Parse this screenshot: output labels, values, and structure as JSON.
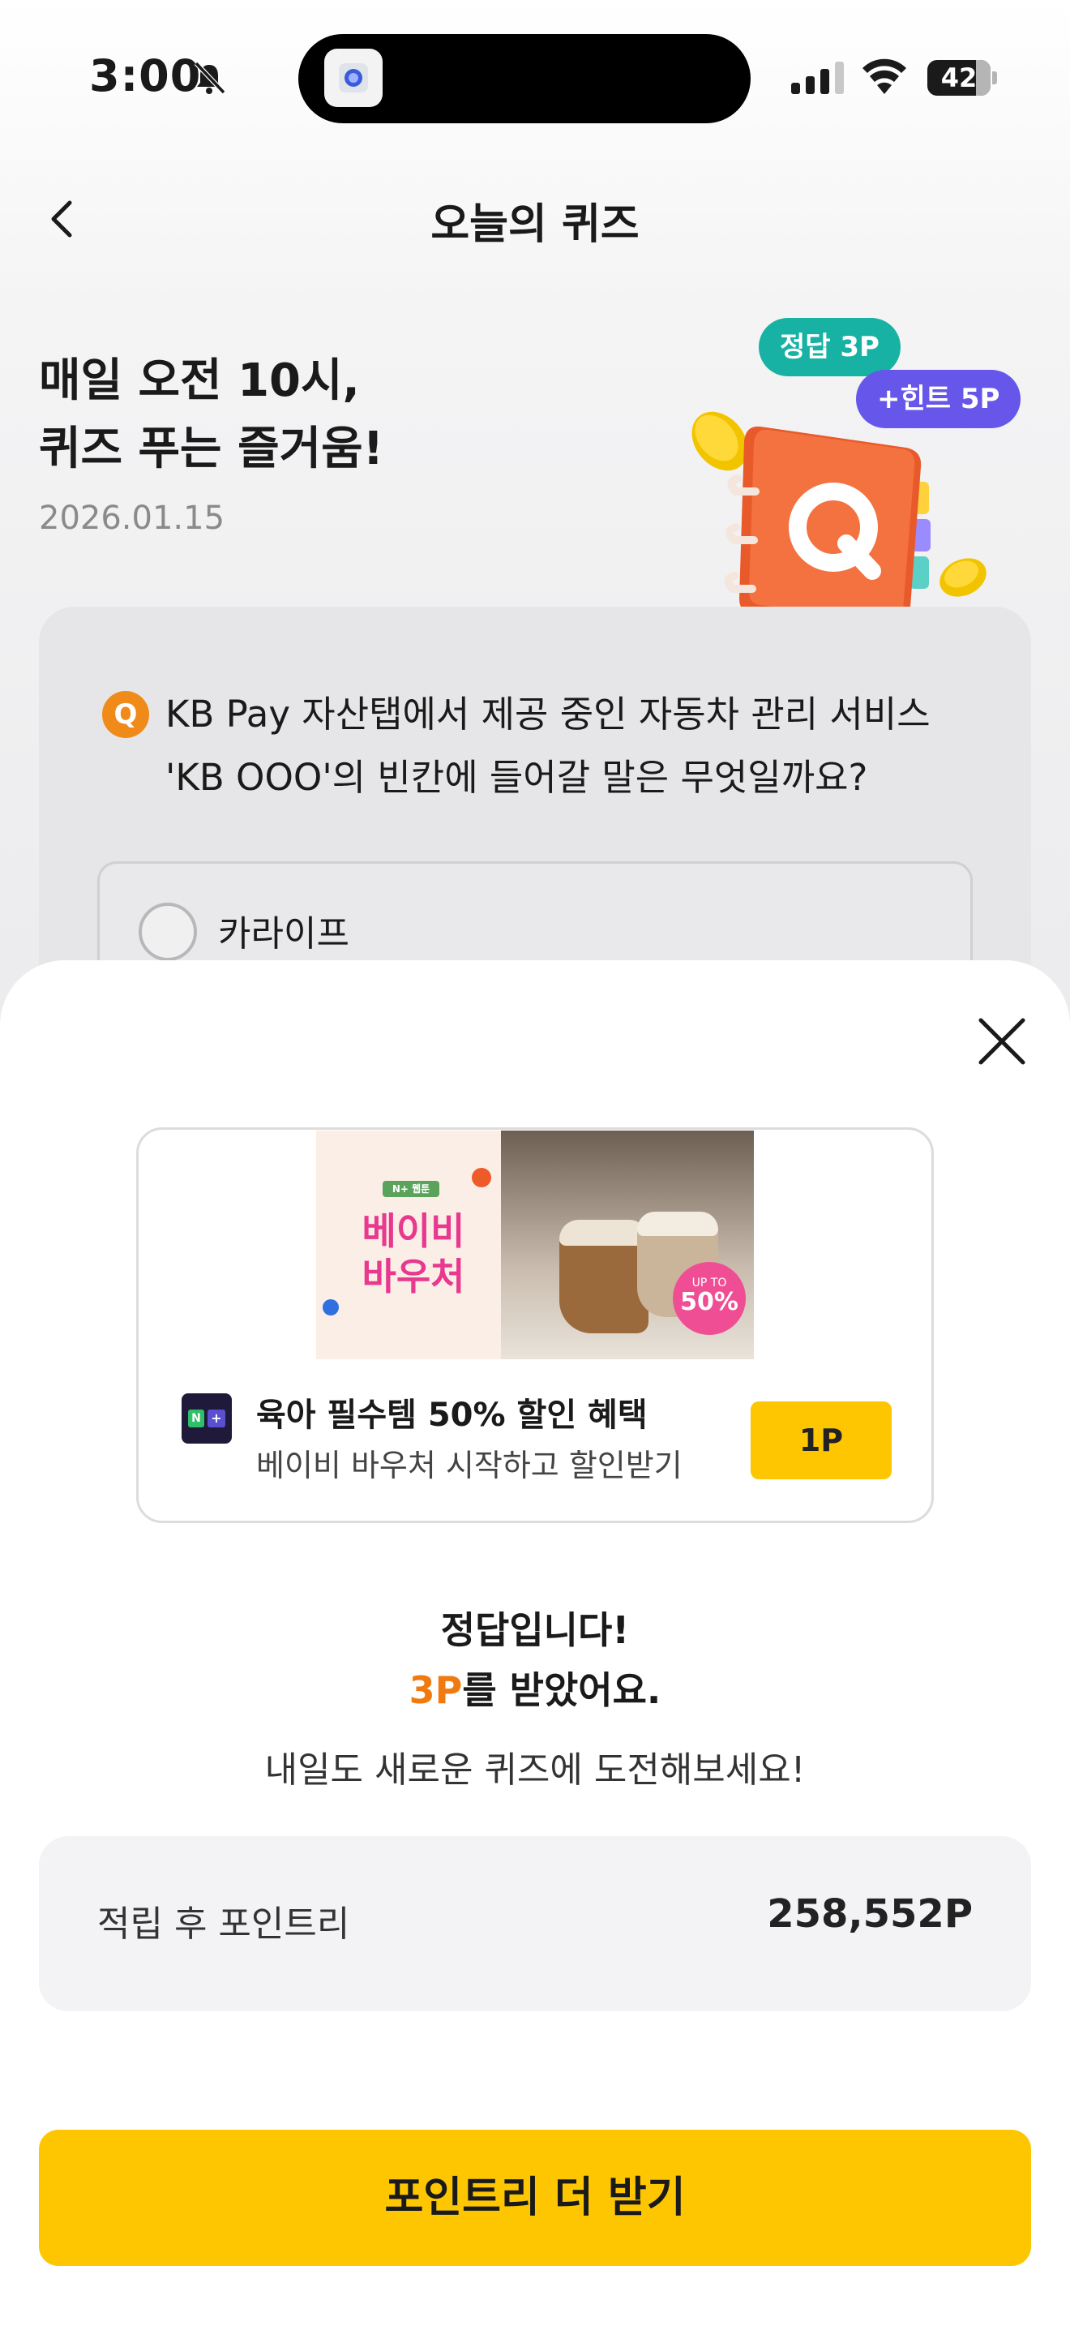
{
  "status_bar": {
    "time": "3:00",
    "battery": "42"
  },
  "nav": {
    "title": "오늘의 퀴즈"
  },
  "hero": {
    "title_line1": "매일 오전 10시,",
    "title_line2": "퀴즈 푸는 즐거움!",
    "date": "2026.01.15",
    "bubble_correct": "정답 3P",
    "bubble_hint": "+힌트 5P",
    "notebook_letter": "Q"
  },
  "quiz": {
    "badge": "Q",
    "question": "KB Pay 자산탭에서 제공 중인 자동차 관리 서비스 'KB OOO'의 빈칸에 들어갈 말은 무엇일까요?",
    "option1": "카라이프"
  },
  "ad": {
    "brand_tag": "N+ 웹툰",
    "banner_text": "베이비 바우처",
    "up_to": "UP TO",
    "percent": "50%",
    "logo_n": "N",
    "logo_plus": "+",
    "title": "육아 필수템 50% 할인 혜택",
    "subtitle": "베이비 바우처 시작하고 할인받기",
    "point_button": "1P"
  },
  "result": {
    "line1": "정답입니다!",
    "points_earned": "3P",
    "line2_suffix": "를 받았어요.",
    "line3": "내일도 새로운 퀴즈에 도전해보세요!"
  },
  "balance": {
    "label": "적립 후 포인트리",
    "value": "258,552P"
  },
  "cta": {
    "label": "포인트리 더 받기"
  },
  "colors": {
    "accent_yellow": "#fec600",
    "accent_orange": "#f07a10",
    "bubble_teal": "#17b2a3",
    "bubble_purple": "#6656ea"
  }
}
